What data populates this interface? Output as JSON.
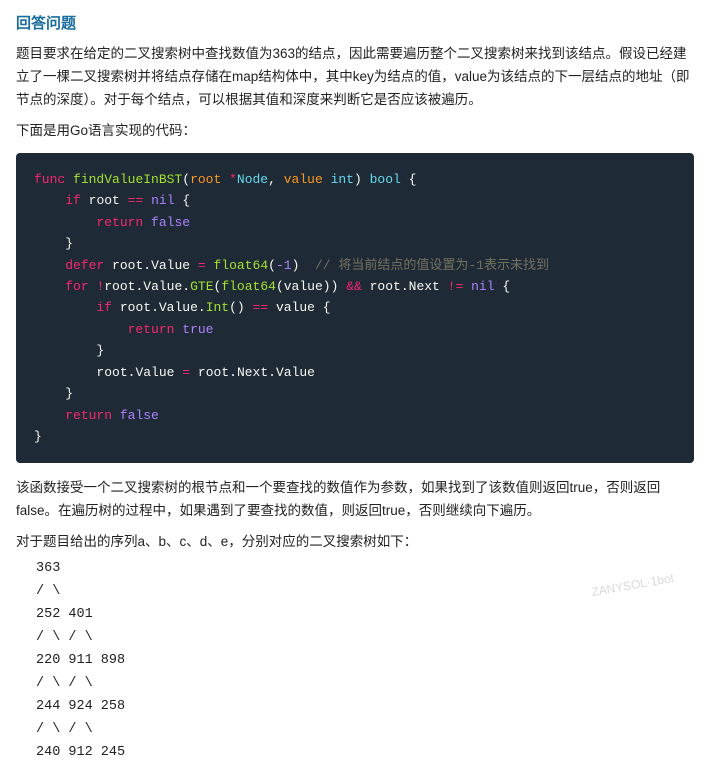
{
  "page": {
    "title": "回答问题",
    "description1": "题目要求在给定的二叉搜索树中查找数值为363的结点，因此需要遍历整个二叉搜索树来找到该结点。假设已经建立了一棵二叉搜索树并将结点存储在map结构体中，其中key为结点的值，value为该结点的下一层结点的地址（即节点的深度）。对于每个结点，可以根据其值和深度来判断它是否应该被遍历。",
    "description2": "下面是用Go语言实现的代码：",
    "code_lines": [
      "func findValueInBST(root *Node, value int) bool {",
      "    if root == nil {",
      "        return false",
      "    }",
      "    defer root.Value = float64(-1)  // 将当前结点的值设置为-1表示未找到",
      "    for !root.Value.GTE(float64(value)) && root.Next != nil {",
      "        if root.Value.Int() == value {",
      "            return true",
      "        }",
      "        root.Value = root.Next.Value",
      "    }",
      "    return false",
      "}"
    ],
    "after_code": "该函数接受一个二叉搜索树的根节点和一个要查找的数值作为参数，如果找到了该数值则返回true，否则返回false。在遍历树的过程中，如果遇到了要查找的数值，则返回true，否则继续向下遍历。",
    "tree_intro": "对于题目给出的序列a、b、c、d、e，分别对应的二叉搜索树如下：",
    "tree_lines": [
      "    363",
      "   / \\",
      " 252 401",
      " / \\ / \\",
      "220 911 898",
      " / \\ / \\",
      "244 924 258",
      " / \\ / \\",
      "240 912 245"
    ],
    "watermark": "ZANYSOL·1bot"
  }
}
